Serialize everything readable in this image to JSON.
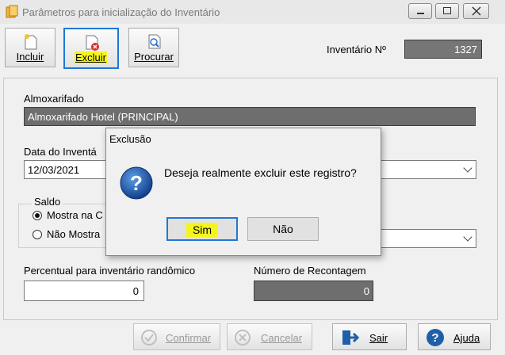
{
  "window": {
    "title": "Parâmetros para inicialização do Inventário"
  },
  "toolbar": {
    "incluir": "Incluir",
    "excluir": "Excluir",
    "procurar": "Procurar",
    "inventario_label": "Inventário Nº",
    "inventario_value": "1327"
  },
  "form": {
    "almoxarifado_label": "Almoxarifado",
    "almoxarifado_value": "Almoxarifado Hotel (PRINCIPAL)",
    "data_label": "Data do Inventá",
    "data_value": "12/03/2021",
    "saldo_label": "Saldo",
    "saldo_opt1": "Mostra na C",
    "saldo_opt2": "Não Mostra",
    "percentual_label": "Percentual para inventário randômico",
    "percentual_value": "0",
    "recontagem_label": "Número de Recontagem",
    "recontagem_value": "0"
  },
  "buttons": {
    "confirmar": "Confirmar",
    "cancelar": "Cancelar",
    "sair": "Sair",
    "ajuda": "Ajuda"
  },
  "dialog": {
    "title": "Exclusão",
    "message": "Deseja realmente excluir este registro?",
    "yes": "Sim",
    "no": "Não"
  },
  "colors": {
    "accent": "#1e78d7",
    "highlight": "#f5f51e"
  }
}
